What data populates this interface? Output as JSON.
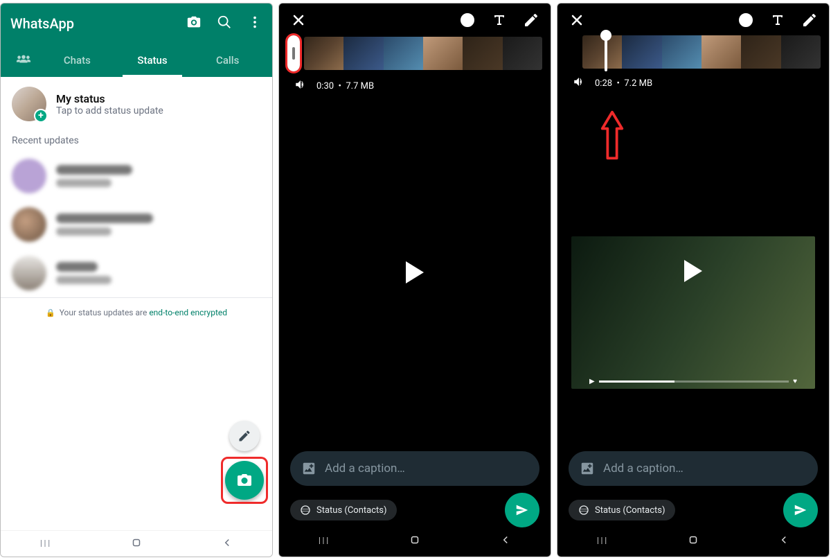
{
  "colors": {
    "primary": "#008069",
    "accent": "#00a884",
    "highlight": "#ef2b2b"
  },
  "panel1": {
    "app_title": "WhatsApp",
    "tabs": {
      "chats": "Chats",
      "status": "Status",
      "calls": "Calls"
    },
    "my_status": {
      "title": "My status",
      "subtitle": "Tap to add status update"
    },
    "section_recent": "Recent updates",
    "encryption_prefix": "Your status updates are ",
    "encryption_link": "end-to-end encrypted"
  },
  "panel2": {
    "duration": "0:30",
    "size": "7.7 MB",
    "caption_placeholder": "Add a caption…",
    "status_chip": "Status (Contacts)"
  },
  "panel3": {
    "duration": "0:28",
    "size": "7.2 MB",
    "caption_placeholder": "Add a caption…",
    "status_chip": "Status (Contacts)"
  },
  "nav": {
    "recents": "|||",
    "home": "○",
    "back": "<"
  }
}
